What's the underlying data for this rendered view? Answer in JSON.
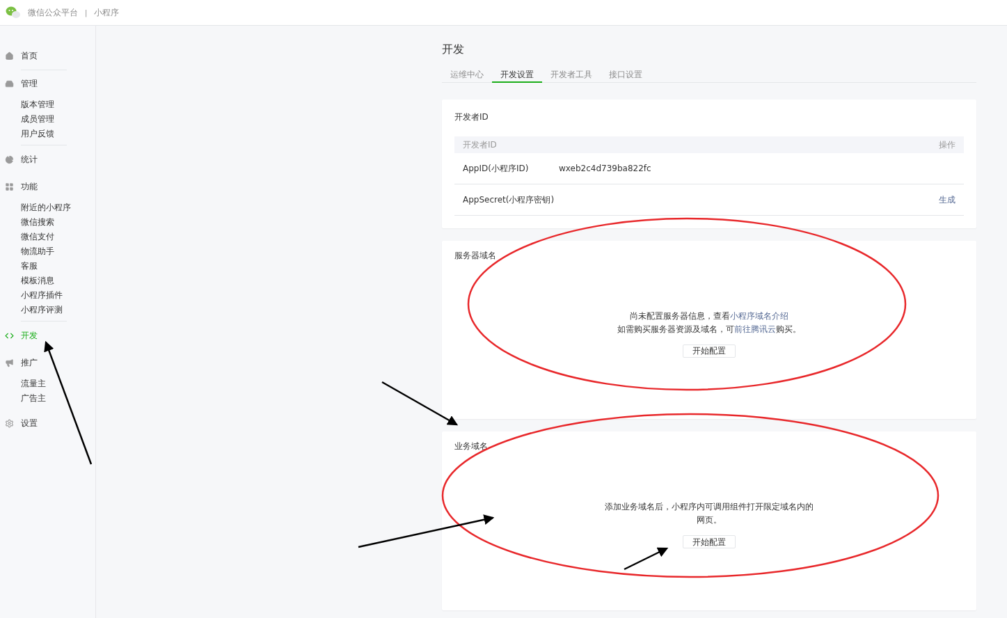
{
  "header": {
    "brand": "微信公众平台",
    "separator": "|",
    "product": "小程序"
  },
  "sidebar": [
    {
      "kind": "group",
      "title": "首页",
      "selected": false
    },
    {
      "kind": "divider"
    },
    {
      "kind": "group",
      "title": "管理",
      "selected": false,
      "children": [
        "版本管理",
        "成员管理",
        "用户反馈"
      ]
    },
    {
      "kind": "divider"
    },
    {
      "kind": "group",
      "title": "统计",
      "selected": false
    },
    {
      "kind": "group",
      "title": "功能",
      "selected": false,
      "children": [
        "附近的小程序",
        "微信搜索",
        "微信支付",
        "物流助手",
        "客服",
        "模板消息",
        "小程序插件",
        "小程序评测"
      ]
    },
    {
      "kind": "divider"
    },
    {
      "kind": "group",
      "title": "开发",
      "selected": true
    },
    {
      "kind": "group",
      "title": "推广",
      "selected": false,
      "children": [
        "流量主",
        "广告主"
      ]
    },
    {
      "kind": "group",
      "title": "设置",
      "selected": false
    }
  ],
  "page_title": "开发",
  "tabs": [
    {
      "label": "运维中心",
      "selected": false
    },
    {
      "label": "开发设置",
      "selected": true
    },
    {
      "label": "开发者工具",
      "selected": false
    },
    {
      "label": "接口设置",
      "selected": false
    }
  ],
  "developer_id": {
    "title": "开发者ID",
    "columns": [
      "开发者ID",
      "操作"
    ],
    "rows": [
      {
        "name": "AppID(小程序ID)",
        "value": "wxeb2c4d739ba822fc"
      },
      {
        "name": "AppSecret(小程序密钥)",
        "action": "生成"
      }
    ]
  },
  "server_domain": {
    "title": "服务器域名",
    "lines": [
      {
        "before": "尚未配置服务器信息，查看",
        "link": "小程序域名介绍"
      },
      {
        "before": "如需购买服务器资源及域名，可",
        "link": "前往腾讯云",
        "after": "购买。"
      }
    ],
    "button": "开始配置"
  },
  "business_domain": {
    "title": "业务域名",
    "lines": [
      {
        "before": "添加业务域名后，小程序内可调用组件打开限定域名内的"
      },
      {
        "before": "网页。"
      }
    ],
    "button": "开始配置"
  }
}
